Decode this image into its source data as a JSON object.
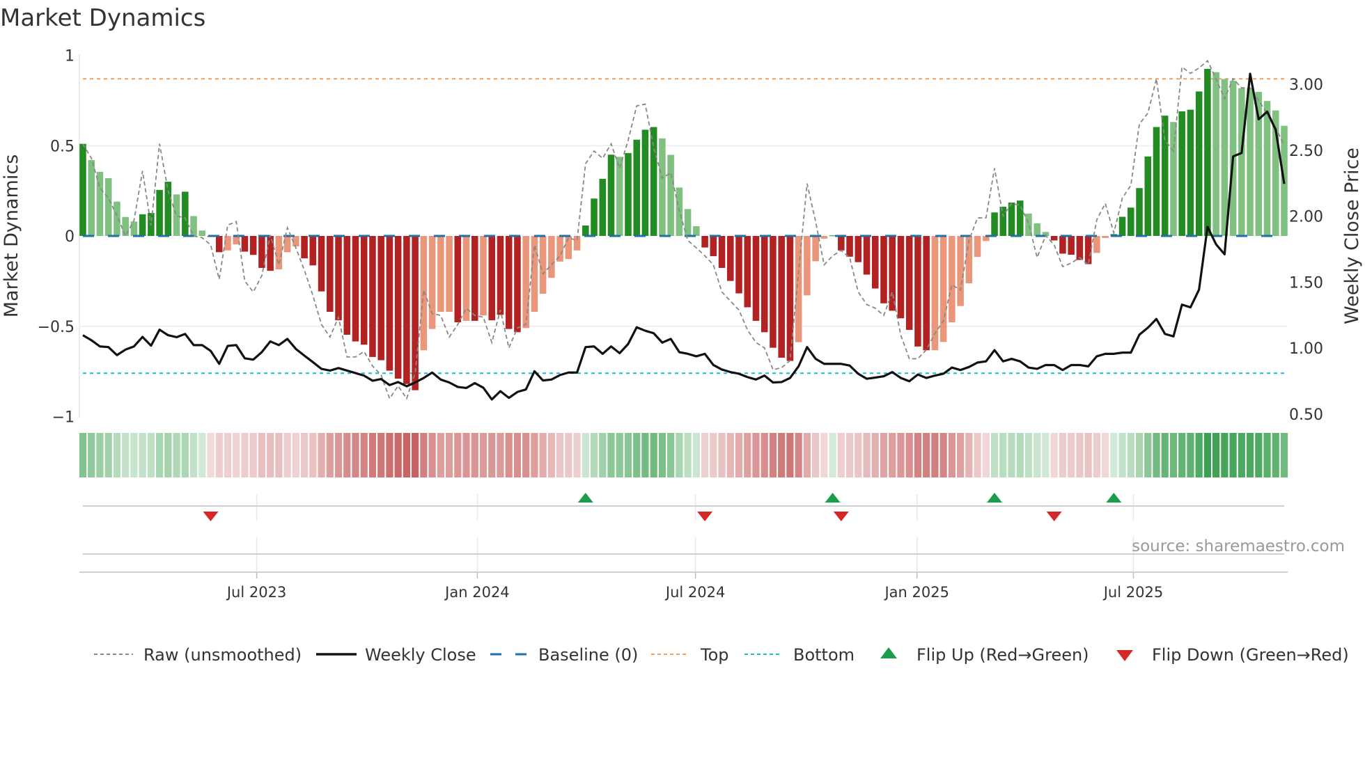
{
  "title": "Market Dynamics",
  "source": "source: sharemaestro.com",
  "chart_data": {
    "type": "bar",
    "title": "Market Dynamics",
    "ylabel": "Market Dynamics",
    "y2label": "Weekly Close Price",
    "ylim": [
      -1,
      1
    ],
    "y2lim": [
      0.5,
      3.0
    ],
    "yticks": [
      "1",
      "0.5",
      "0",
      "−0.5",
      "−1"
    ],
    "ytick_values": [
      1,
      0.5,
      0,
      -0.5,
      -1
    ],
    "y2ticks": [
      "3.00",
      "2.50",
      "2.00",
      "1.50",
      "1.00",
      "0.50"
    ],
    "y2tick_values": [
      3.0,
      2.5,
      2.0,
      1.5,
      1.0,
      0.5
    ],
    "xticks": [
      {
        "label": "Jul 2023",
        "week_index": 20.4
      },
      {
        "label": "Jan 2024",
        "week_index": 46.3
      },
      {
        "label": "Jul 2024",
        "week_index": 71.9
      },
      {
        "label": "Jan 2025",
        "week_index": 97.9
      },
      {
        "label": "Jul 2025",
        "week_index": 123.3
      }
    ],
    "top_level": 0.87,
    "bottom_level": -0.76,
    "baseline": 0,
    "grid": true,
    "legend_position": "bottom",
    "colors": {
      "strong_green": "#228b22",
      "weak_green": "#80c080",
      "strong_red": "#b22222",
      "weak_red": "#e9967a",
      "baseline": "#1f6fa8",
      "top": "#f0a060",
      "bottom": "#17becf",
      "raw": "#888888",
      "close": "#111111",
      "flip_up": "#1a9e4a",
      "flip_down": "#d62728"
    },
    "series": [
      {
        "name": "Market Dynamics (smoothed)",
        "values": [
          0.51,
          0.42,
          0.355,
          0.32,
          0.19,
          0.105,
          0.08,
          0.12,
          0.127,
          0.255,
          0.3,
          0.23,
          0.245,
          0.11,
          0.03,
          -0.005,
          -0.09,
          -0.08,
          -0.047,
          -0.087,
          -0.105,
          -0.177,
          -0.193,
          -0.185,
          -0.09,
          -0.058,
          -0.124,
          -0.163,
          -0.307,
          -0.42,
          -0.467,
          -0.547,
          -0.584,
          -0.602,
          -0.67,
          -0.688,
          -0.746,
          -0.79,
          -0.82,
          -0.854,
          -0.633,
          -0.515,
          -0.42,
          -0.42,
          -0.478,
          -0.47,
          -0.47,
          -0.44,
          -0.467,
          -0.437,
          -0.515,
          -0.533,
          -0.51,
          -0.42,
          -0.32,
          -0.232,
          -0.142,
          -0.128,
          -0.08,
          0.058,
          0.207,
          0.316,
          0.45,
          0.438,
          0.459,
          0.533,
          0.588,
          0.603,
          0.54,
          0.449,
          0.268,
          0.149,
          0.054,
          -0.064,
          -0.112,
          -0.177,
          -0.249,
          -0.318,
          -0.395,
          -0.47,
          -0.533,
          -0.619,
          -0.674,
          -0.692,
          -0.588,
          -0.329,
          -0.14,
          -0.015,
          0.003,
          -0.08,
          -0.115,
          -0.145,
          -0.214,
          -0.291,
          -0.373,
          -0.414,
          -0.456,
          -0.52,
          -0.612,
          -0.633,
          -0.633,
          -0.587,
          -0.478,
          -0.388,
          -0.262,
          -0.116,
          -0.028,
          0.13,
          0.162,
          0.185,
          0.196,
          0.124,
          0.07,
          0.022,
          -0.025,
          -0.098,
          -0.104,
          -0.133,
          -0.156,
          -0.094,
          -0.011,
          0.01,
          0.106,
          0.157,
          0.265,
          0.44,
          0.603,
          0.666,
          0.631,
          0.69,
          0.699,
          0.8,
          0.925,
          0.907,
          0.869,
          0.859,
          0.818,
          0.818,
          0.798,
          0.747,
          0.695,
          0.61
        ],
        "strong": [
          1,
          0,
          0,
          0,
          0,
          0,
          0,
          1,
          1,
          1,
          1,
          0,
          1,
          0,
          0,
          1,
          1,
          0,
          0,
          1,
          1,
          1,
          1,
          0,
          0,
          0,
          1,
          1,
          1,
          1,
          1,
          1,
          1,
          1,
          1,
          1,
          1,
          1,
          1,
          1,
          0,
          0,
          0,
          0,
          1,
          0,
          1,
          0,
          1,
          1,
          1,
          1,
          0,
          0,
          0,
          0,
          0,
          0,
          0,
          1,
          1,
          1,
          1,
          0,
          1,
          1,
          1,
          1,
          0,
          0,
          0,
          0,
          0,
          1,
          1,
          1,
          1,
          1,
          1,
          1,
          1,
          1,
          1,
          1,
          0,
          0,
          0,
          0,
          1,
          1,
          1,
          1,
          1,
          1,
          1,
          1,
          1,
          1,
          1,
          1,
          0,
          0,
          0,
          0,
          0,
          0,
          0,
          1,
          1,
          1,
          1,
          0,
          0,
          0,
          1,
          1,
          1,
          1,
          1,
          0,
          0,
          1,
          1,
          1,
          1,
          1,
          1,
          1,
          0,
          1,
          1,
          1,
          1,
          0,
          0,
          0,
          0,
          0,
          0,
          0,
          0,
          0
        ]
      },
      {
        "name": "Raw (unsmoothed)",
        "values": [
          0.51,
          0.43,
          0.265,
          0.21,
          0.113,
          0,
          0.086,
          0.36,
          0.058,
          0.51,
          0.25,
          0.11,
          0.1,
          0,
          -0.01,
          -0.05,
          -0.24,
          0.06,
          0.08,
          -0.25,
          -0.31,
          -0.22,
          0.005,
          -0.16,
          0.045,
          -0.066,
          -0.19,
          -0.33,
          -0.49,
          -0.56,
          -0.45,
          -0.67,
          -0.67,
          -0.64,
          -0.72,
          -0.77,
          -0.9,
          -0.83,
          -0.9,
          -0.76,
          -0.3,
          -0.43,
          -0.44,
          -0.56,
          -0.49,
          -0.4,
          -0.44,
          -0.45,
          -0.59,
          -0.41,
          -0.62,
          -0.51,
          -0.49,
          -0.05,
          -0.21,
          -0.16,
          -0.11,
          -0.01,
          -0.025,
          0.4,
          0.47,
          0.43,
          0.51,
          0.375,
          0.53,
          0.72,
          0.73,
          0.49,
          0.32,
          0.35,
          0.14,
          -0.025,
          -0.066,
          -0.11,
          -0.16,
          -0.31,
          -0.36,
          -0.41,
          -0.52,
          -0.59,
          -0.62,
          -0.74,
          -0.73,
          -0.69,
          -0.2,
          0.29,
          0.08,
          -0.16,
          -0.11,
          -0.08,
          -0.12,
          -0.31,
          -0.38,
          -0.4,
          -0.44,
          -0.31,
          -0.55,
          -0.68,
          -0.68,
          -0.63,
          -0.54,
          -0.47,
          -0.27,
          -0.3,
          -0.025,
          0.1,
          0.1,
          0.375,
          0.11,
          0.18,
          0.17,
          0.07,
          -0.12,
          0.003,
          -0.05,
          -0.17,
          -0.15,
          -0.12,
          -0.16,
          0.09,
          0.18,
          0.017,
          0.21,
          0.28,
          0.62,
          0.68,
          0.87,
          0.53,
          0.47,
          0.935,
          0.9,
          0.93,
          0.97,
          0.87,
          0.76,
          0.87,
          0.82,
          0.82,
          0.75,
          0.68,
          0.6,
          0.5
        ]
      },
      {
        "name": "Weekly Close",
        "axis": "right",
        "values": [
          1.098,
          1.06,
          1.013,
          1.008,
          0.947,
          0.989,
          1.013,
          1.085,
          1.019,
          1.14,
          1.098,
          1.083,
          1.108,
          1.023,
          1.023,
          0.979,
          0.881,
          1.017,
          1.023,
          0.923,
          0.913,
          0.97,
          1.051,
          1.023,
          1.07,
          0.994,
          0.943,
          0.894,
          0.843,
          0.83,
          0.849,
          0.83,
          0.811,
          0.792,
          0.753,
          0.766,
          0.72,
          0.743,
          0.711,
          0.74,
          0.774,
          0.815,
          0.762,
          0.74,
          0.706,
          0.698,
          0.735,
          0.7,
          0.611,
          0.674,
          0.623,
          0.668,
          0.687,
          0.825,
          0.755,
          0.762,
          0.796,
          0.815,
          0.815,
          1.008,
          1.013,
          0.957,
          1.013,
          0.962,
          1.032,
          1.158,
          1.132,
          1.113,
          1.042,
          1.07,
          0.97,
          0.957,
          0.938,
          0.957,
          0.872,
          0.838,
          0.819,
          0.806,
          0.781,
          0.762,
          0.792,
          0.74,
          0.743,
          0.774,
          0.862,
          1.008,
          0.919,
          0.881,
          0.881,
          0.881,
          0.868,
          0.806,
          0.768,
          0.777,
          0.787,
          0.819,
          0.774,
          0.749,
          0.8,
          0.774,
          0.792,
          0.806,
          0.853,
          0.834,
          0.857,
          0.891,
          0.9,
          0.985,
          0.9,
          0.919,
          0.9,
          0.853,
          0.843,
          0.872,
          0.872,
          0.834,
          0.872,
          0.872,
          0.862,
          0.938,
          0.957,
          0.957,
          0.966,
          0.966,
          1.102,
          1.155,
          1.221,
          1.108,
          1.089,
          1.33,
          1.309,
          1.443,
          1.919,
          1.787,
          1.711,
          2.453,
          2.479,
          3.079,
          2.734,
          2.792,
          2.655,
          2.245
        ]
      }
    ],
    "flips_up": [
      59,
      88,
      107,
      121
    ],
    "flips_down": [
      15,
      73,
      89,
      114
    ],
    "legend": [
      {
        "label": "Raw (unsmoothed)",
        "kind": "raw"
      },
      {
        "label": "Weekly Close",
        "kind": "close"
      },
      {
        "label": "Baseline (0)",
        "kind": "baseline"
      },
      {
        "label": "Top",
        "kind": "top"
      },
      {
        "label": "Bottom",
        "kind": "bottom"
      },
      {
        "label": "Flip Up (Red→Green)",
        "kind": "up"
      },
      {
        "label": "Flip Down (Green→Red)",
        "kind": "down"
      }
    ]
  }
}
